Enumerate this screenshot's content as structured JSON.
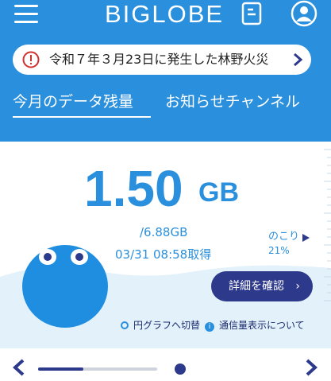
{
  "header": {
    "logo_text": "BIGLOBE",
    "icons": [
      "hamburger-menu-icon",
      "news-icon",
      "account-icon"
    ]
  },
  "alert": {
    "text": "令和７年３月23日に発生した林野火災",
    "icons": [
      "warning-icon",
      "chevron-right-icon"
    ]
  },
  "tabs": [
    {
      "label": "今月のデータ残量",
      "active": true
    },
    {
      "label": "お知らせチャンネル",
      "active": false
    }
  ],
  "usage": {
    "remaining_value": "1.50",
    "remaining_unit": "GB",
    "total": "/6.88GB",
    "fetched_at": "03/31 08:58取得",
    "remaining_label": "のこり",
    "remaining_percent": "21%"
  },
  "actions": {
    "detail_button": "詳細を確認",
    "detail_arrow": "›",
    "toggle_chart": "円グラフへ切替",
    "usage_display_link": "通信量表示について",
    "info_glyph": "i"
  },
  "pager": {
    "progress": 0.38
  },
  "colors": {
    "primary_blue": "#2a8fdc",
    "navy": "#2d3a8c",
    "wave_light": "#e3f1fb"
  }
}
